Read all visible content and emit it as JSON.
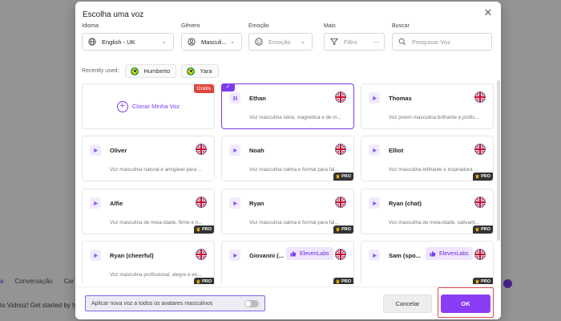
{
  "background": {
    "tabs": [
      "a",
      "Conversação",
      "Car"
    ],
    "footer_text": "to Vidnoz! Get started by typ"
  },
  "modal": {
    "title": "Escolha uma voz",
    "filters": {
      "idioma": {
        "label": "Idioma",
        "value": "English - UK"
      },
      "genero": {
        "label": "Gênero",
        "value": "Masculi..."
      },
      "emocao": {
        "label": "Emoção",
        "placeholder": "Emoção"
      },
      "mais": {
        "label": "Mais",
        "placeholder": "Filtro",
        "extra": "···"
      },
      "buscar": {
        "label": "Buscar",
        "placeholder": "Pesquisar Voz"
      }
    },
    "recent": {
      "label": "Recently used:",
      "items": [
        {
          "name": "Humberto",
          "flag": "brazil"
        },
        {
          "name": "Yara",
          "flag": "brazil"
        }
      ]
    },
    "clone": {
      "label": "Clonar Minha Voz",
      "badge": "Grátis"
    },
    "voices": [
      {
        "name": "Ethan",
        "desc": "Voz masculina séria, magnética e de m...",
        "flag": "uk",
        "pro": false,
        "selected": true
      },
      {
        "name": "Thomas",
        "desc": "Voz jovem masculina brilhante e profis...",
        "flag": "uk",
        "pro": false
      },
      {
        "name": "Oliver",
        "desc": "Voz masculina natural e amigável para ...",
        "flag": "uk",
        "pro": false
      },
      {
        "name": "Noah",
        "desc": "Voz masculina calma e formal para fal...",
        "flag": "uk",
        "pro": true
      },
      {
        "name": "Elliot",
        "desc": "Voz masculina brilhante e inspiradora ...",
        "flag": "uk",
        "pro": true
      },
      {
        "name": "Alfie",
        "desc": "Voz masculina de meia-idade, firme e n...",
        "flag": "uk",
        "pro": true
      },
      {
        "name": "Ryan",
        "desc": "Voz masculina calma e formal para fal...",
        "flag": "uk",
        "pro": true
      },
      {
        "name": "Ryan (chat)",
        "desc": "Voz masculina de meia-idade, cativant...",
        "flag": "uk",
        "pro": true
      },
      {
        "name": "Ryan (cheerful)",
        "desc": "Voz masculina profissional, alegre e en...",
        "flag": "uk",
        "pro": true
      },
      {
        "name": "Giovanni (...",
        "desc": "",
        "flag": "uk",
        "pro": true,
        "eleven": "ElevenLabs"
      },
      {
        "name": "Sam (spo...",
        "desc": "",
        "flag": "uk",
        "pro": true,
        "eleven": "ElevenLabs"
      }
    ],
    "pro_label": "PRO",
    "footer": {
      "apply_label": "Aplicar nova voz a todos os avatares masculinos",
      "apply_toggle": false,
      "cancel_label": "Cancelar",
      "ok_label": "OK"
    }
  },
  "colors": {
    "accent": "#8b3cf5",
    "gratis": "#e0463c",
    "highlight": "#e0465a"
  }
}
